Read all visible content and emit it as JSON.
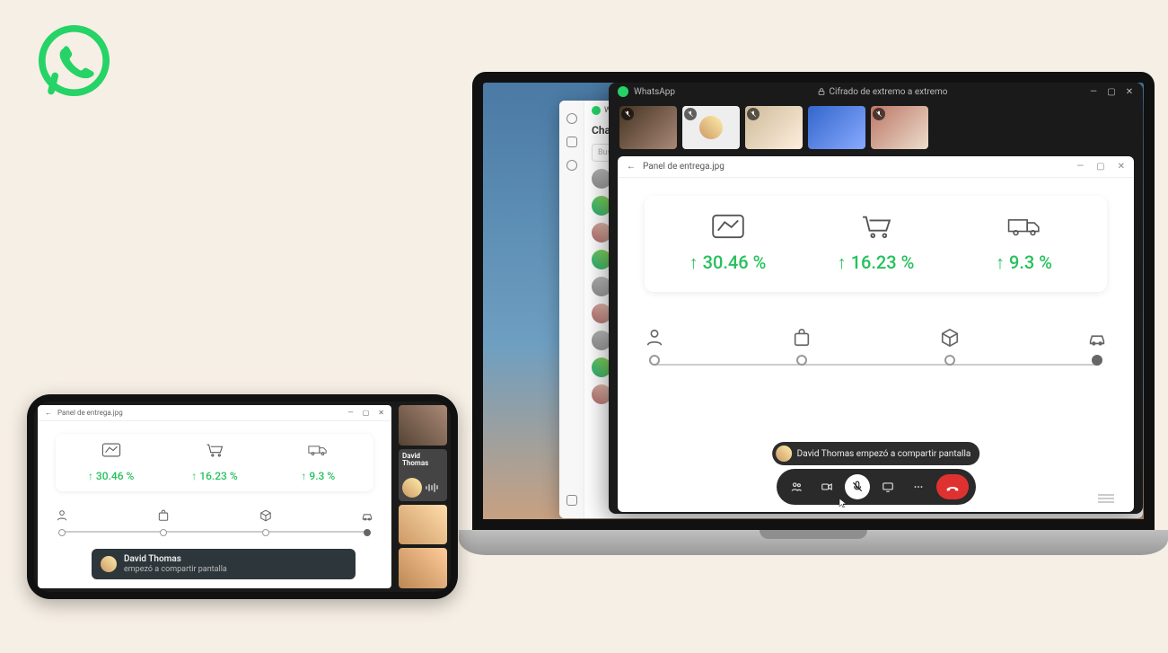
{
  "logo": {
    "name": "whatsapp-logo"
  },
  "desktop_chat": {
    "app_name": "Wha…",
    "header": "Chat",
    "search_placeholder": "Busc…"
  },
  "call_window": {
    "app_name": "WhatsApp",
    "e2e_label": "Cifrado de extremo a extremo",
    "window_controls": {
      "min": "—",
      "max": "▢",
      "close": "✕"
    },
    "participants": [
      {
        "muted": true
      },
      {
        "muted": true,
        "avatar_mode": true
      },
      {
        "muted": true
      },
      {
        "muted": false
      },
      {
        "muted": true
      }
    ],
    "share": {
      "back": "←",
      "title": "Panel de entrega.jpg",
      "window_controls": {
        "min": "—",
        "max": "▢",
        "close": "✕"
      },
      "metrics": [
        {
          "icon": "chart",
          "value": "↑ 30.46 %"
        },
        {
          "icon": "cart",
          "value": "↑ 16.23 %"
        },
        {
          "icon": "truck",
          "value": "↑ 9.3 %"
        }
      ],
      "steps": [
        {
          "icon": "person",
          "active": false
        },
        {
          "icon": "bag",
          "active": false
        },
        {
          "icon": "package",
          "active": false
        },
        {
          "icon": "car",
          "active": true
        }
      ]
    },
    "toast": {
      "text": "David Thomas empezó a compartir pantalla"
    },
    "toolbar": {
      "buttons": [
        "participants",
        "video",
        "mute",
        "share",
        "more",
        "end"
      ]
    }
  },
  "phone": {
    "share": {
      "back": "←",
      "title": "Panel de entrega.jpg",
      "window_controls": {
        "min": "—",
        "max": "▢",
        "close": "✕"
      },
      "metrics": [
        {
          "icon": "chart",
          "value": "↑ 30.46 %"
        },
        {
          "icon": "cart",
          "value": "↑ 16.23 %"
        },
        {
          "icon": "truck",
          "value": "↑ 9.3 %"
        }
      ],
      "steps": [
        {
          "icon": "person",
          "active": false
        },
        {
          "icon": "bag",
          "active": false
        },
        {
          "icon": "package",
          "active": false
        },
        {
          "icon": "car",
          "active": true
        }
      ]
    },
    "toast": {
      "name": "David Thomas",
      "sub": "empezó a compartir pantalla"
    },
    "participant_named": "David Thomas"
  }
}
